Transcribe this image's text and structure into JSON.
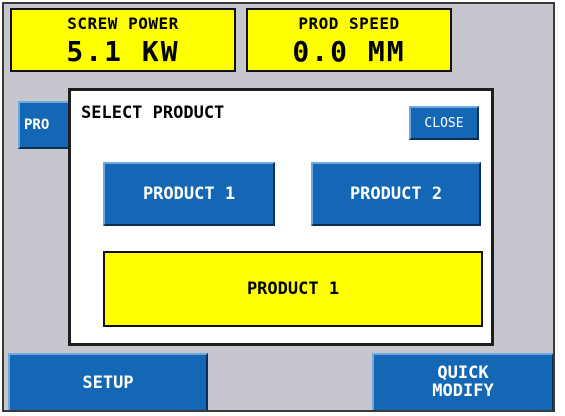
{
  "readouts": {
    "screw_power": {
      "label": "SCREW POWER",
      "value": "5.1 KW"
    },
    "prod_speed": {
      "label": "PROD SPEED",
      "value": "0.0 MM"
    }
  },
  "background": {
    "prod_button_label": "PRO"
  },
  "dialog": {
    "title": "SELECT PRODUCT",
    "close_label": "CLOSE",
    "product_buttons": [
      "PRODUCT 1",
      "PRODUCT 2"
    ],
    "selected_product": "PRODUCT 1"
  },
  "bottom_bar": {
    "setup_label": "SETUP",
    "quick_modify_label": "QUICK\nMODIFY"
  },
  "colors": {
    "readout_bg": "#ffff00",
    "button_blue": "#1467b4",
    "screen_bg": "#c6c6ce"
  }
}
